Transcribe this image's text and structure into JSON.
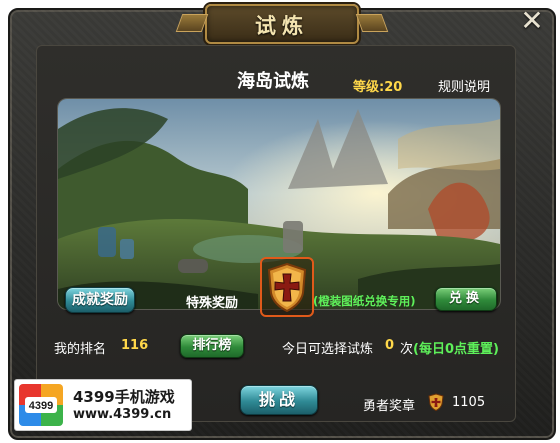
{
  "window": {
    "title": "试炼",
    "close_icon": "close-x-icon"
  },
  "stage": {
    "name": "海岛试炼",
    "level": "等级:20",
    "rules_link": "规则说明",
    "scene_description_icon": "island-landscape"
  },
  "rewards": {
    "achievement_button": "成就奖励",
    "special_label": "特殊奖励",
    "special_item_icon": "shield-cross-icon",
    "exchange_note": "(橙装图纸兑换专用)",
    "exchange_button": "兑换"
  },
  "ranking": {
    "label": "我的排名",
    "value": "116",
    "button": "排行榜"
  },
  "daily": {
    "label": "今日可选择试炼",
    "count": "0",
    "unit": "次",
    "reset_note": "(每日0点重置)"
  },
  "actions": {
    "challenge_button": "挑战"
  },
  "medal": {
    "label": "勇者奖章",
    "icon": "medal-shield-icon",
    "value": "1105"
  },
  "watermark": {
    "logo_text": "4399",
    "title": "4399手机游戏",
    "url": "www.4399.cn"
  },
  "colors": {
    "accent_yellow": "#ffd84a",
    "accent_green": "#5ef05a",
    "highlight_orange": "#e05a1a"
  }
}
